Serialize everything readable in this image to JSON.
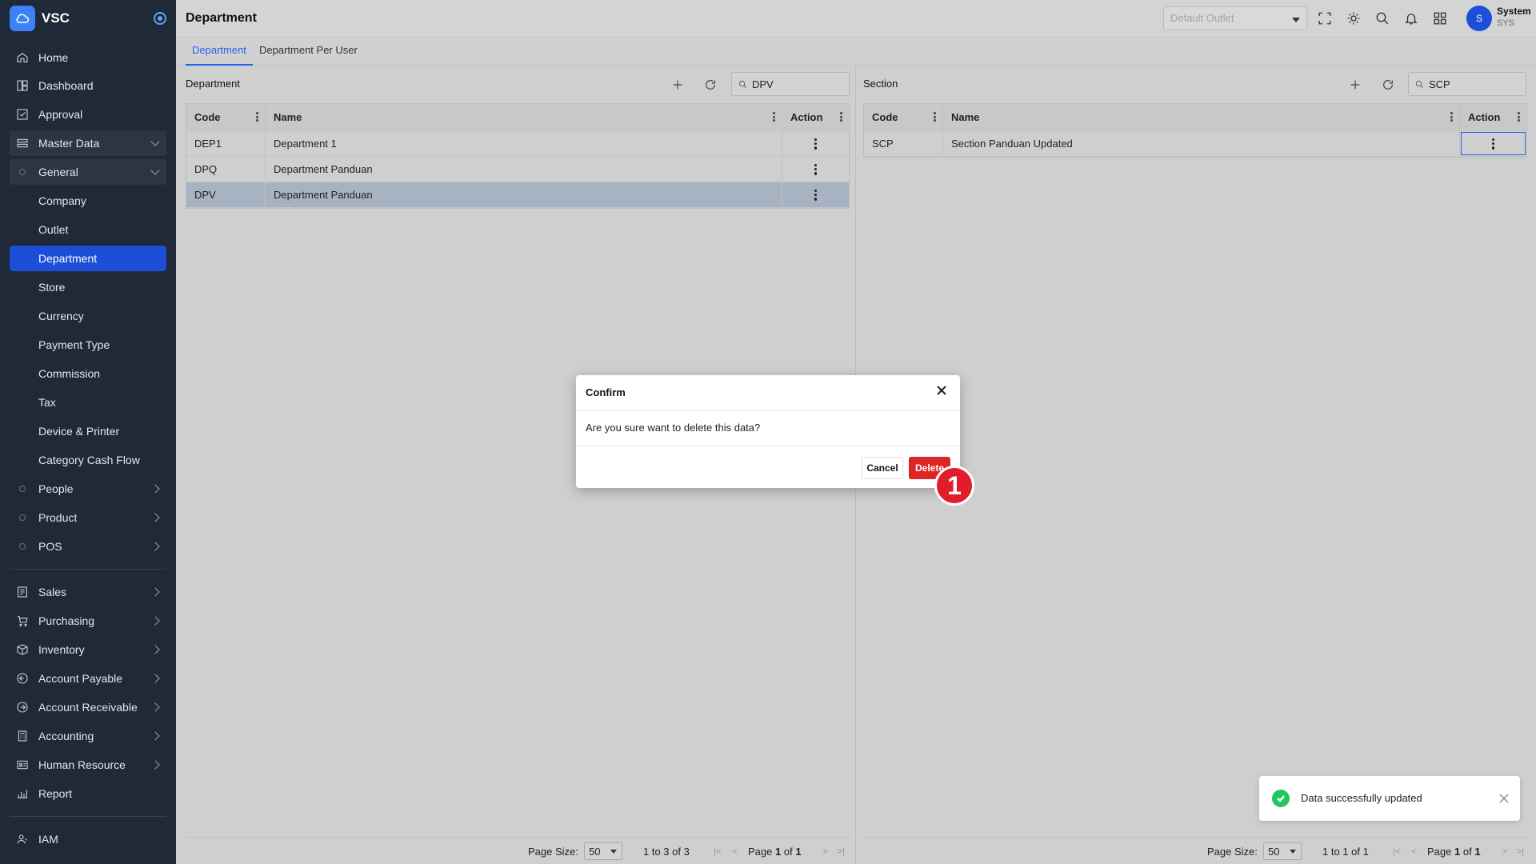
{
  "app": {
    "name": "VSC"
  },
  "sidebar": {
    "items": [
      {
        "label": "Home",
        "icon": "home-icon"
      },
      {
        "label": "Dashboard",
        "icon": "dashboard-icon"
      },
      {
        "label": "Approval",
        "icon": "approval-icon"
      },
      {
        "label": "Master Data",
        "icon": "database-icon"
      },
      {
        "label": "General"
      },
      {
        "label": "Company"
      },
      {
        "label": "Outlet"
      },
      {
        "label": "Department"
      },
      {
        "label": "Store"
      },
      {
        "label": "Currency"
      },
      {
        "label": "Payment Type"
      },
      {
        "label": "Commission"
      },
      {
        "label": "Tax"
      },
      {
        "label": "Device & Printer"
      },
      {
        "label": "Category Cash Flow"
      },
      {
        "label": "People"
      },
      {
        "label": "Product"
      },
      {
        "label": "POS"
      },
      {
        "label": "Sales",
        "icon": "sales-icon"
      },
      {
        "label": "Purchasing",
        "icon": "cart-icon"
      },
      {
        "label": "Inventory",
        "icon": "box-icon"
      },
      {
        "label": "Account Payable",
        "icon": "payable-icon"
      },
      {
        "label": "Account Receivable",
        "icon": "receivable-icon"
      },
      {
        "label": "Accounting",
        "icon": "calculator-icon"
      },
      {
        "label": "Human Resource",
        "icon": "id-card-icon"
      },
      {
        "label": "Report",
        "icon": "report-icon"
      },
      {
        "label": "IAM",
        "icon": "users-icon"
      }
    ]
  },
  "header": {
    "title": "Department",
    "outlet_placeholder": "Default Outlet",
    "user": {
      "initial": "S",
      "name": "System",
      "code": "SYS"
    }
  },
  "tabs": [
    {
      "label": "Department"
    },
    {
      "label": "Department Per User"
    }
  ],
  "department_panel": {
    "title": "Department",
    "search_value": "DPV",
    "columns": [
      "Code",
      "Name",
      "Action"
    ],
    "rows": [
      {
        "code": "DEP1",
        "name": "Department 1"
      },
      {
        "code": "DPQ",
        "name": "Department Panduan"
      },
      {
        "code": "DPV",
        "name": "Department Panduan"
      }
    ],
    "footer": {
      "page_size_label": "Page Size:",
      "page_size": "50",
      "range": "1 to 3 of 3",
      "page_word": "Page",
      "page_num": "1",
      "of_word": "of",
      "page_total": "1"
    }
  },
  "section_panel": {
    "title": "Section",
    "search_value": "SCP",
    "columns": [
      "Code",
      "Name",
      "Action"
    ],
    "rows": [
      {
        "code": "SCP",
        "name": "Section Panduan Updated"
      }
    ],
    "footer": {
      "page_size_label": "Page Size:",
      "page_size": "50",
      "range": "1 to 1 of 1",
      "page_word": "Page",
      "page_num": "1",
      "of_word": "of",
      "page_total": "1"
    }
  },
  "modal": {
    "title": "Confirm",
    "message": "Are you sure want to delete this data?",
    "cancel_label": "Cancel",
    "delete_label": "Delete"
  },
  "step_badge": "1",
  "toast": {
    "message": "Data successfully updated"
  },
  "colors": {
    "sidebar_bg": "#1f2937",
    "active": "#1d4ed8",
    "danger": "#dc2626",
    "success": "#22c55e"
  }
}
